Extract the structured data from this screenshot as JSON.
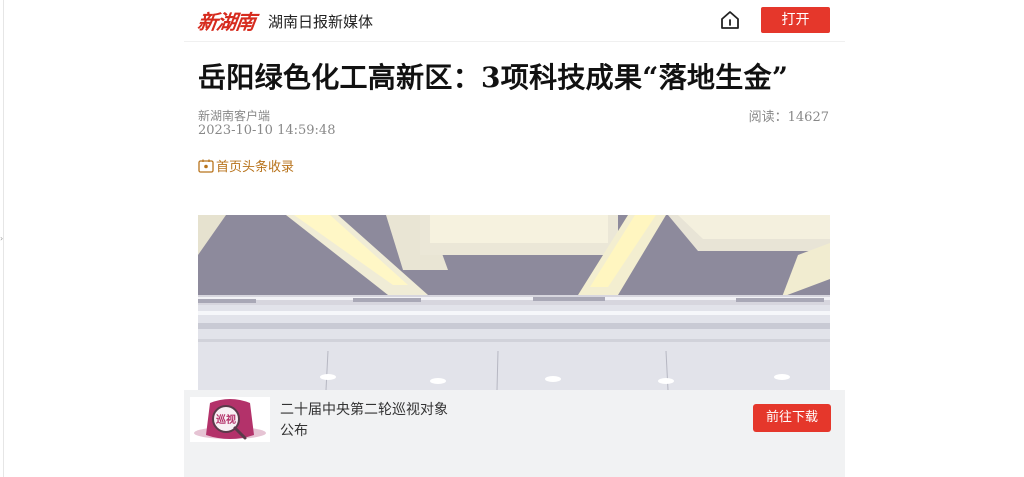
{
  "header": {
    "logo_text": "新湖南",
    "media_name": "湖南日报新媒体",
    "open_label": "打开"
  },
  "article": {
    "title": "岳阳绿色化工高新区：3项科技成果“落地生金”",
    "source": "新湖南客户端",
    "datetime": "2023-10-10 14:59:48",
    "reads_label": "阅读：",
    "reads_count": "14627",
    "record_label": "首页头条收录"
  },
  "banner": {
    "thumb_text": "巡视",
    "line1": "二十届中央第二轮巡视对象",
    "line2": "公布",
    "download_label": "前往下载"
  },
  "colors": {
    "accent_red": "#e5372b",
    "record_gold": "#b8731c",
    "banner_bg": "#f1f2f3"
  }
}
